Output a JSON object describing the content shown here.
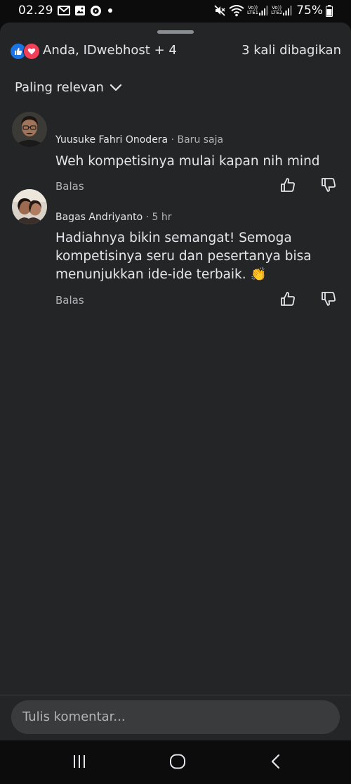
{
  "status_bar": {
    "time": "02.29",
    "left_icons": [
      "gmail-icon",
      "gallery-icon",
      "media-play-icon",
      "notification-dot-icon"
    ],
    "right_icons": [
      "mute-icon",
      "wifi-icon",
      "signal-sim1-icon",
      "signal-sim2-icon",
      "battery-icon"
    ],
    "sim1_label_top": "Vo))",
    "sim1_label_bottom": "LTE1",
    "sim2_label_top": "Vo))",
    "sim2_label_bottom": "LTE2",
    "battery": "75%"
  },
  "sheet": {
    "reactions": {
      "icons": [
        "like-reaction-icon",
        "love-reaction-icon"
      ],
      "reactors": "Anda, IDwebhost + 4",
      "shares": "3 kali dibagikan"
    },
    "sort": {
      "label": "Paling relevan",
      "icon": "chevron-down-icon"
    },
    "comments": [
      {
        "author": "Yuusuke Fahri Onodera",
        "separator": "·",
        "time": "Baru saja",
        "text": "Weh kompetisinya mulai kapan nih mind",
        "reply_label": "Balas"
      },
      {
        "author": "Bagas Andriyanto",
        "separator": "·",
        "time": "5 hr",
        "text": "Hadiahnya bikin semangat! Semoga kompetisinya seru dan pesertanya bisa menunjukkan ide-ide terbaik. 👏",
        "reply_label": "Balas"
      }
    ],
    "composer": {
      "placeholder": "Tulis komentar..."
    }
  },
  "nav_bar": {
    "buttons": [
      "recent-apps-icon",
      "home-icon",
      "back-icon"
    ]
  },
  "colors": {
    "sheet_bg": "#242526",
    "text_primary": "#e4e6eb",
    "text_secondary": "#b0b3b8",
    "like_blue": "#1b74e4",
    "love_red": "#f33e58",
    "input_bg": "#3a3b3c"
  }
}
